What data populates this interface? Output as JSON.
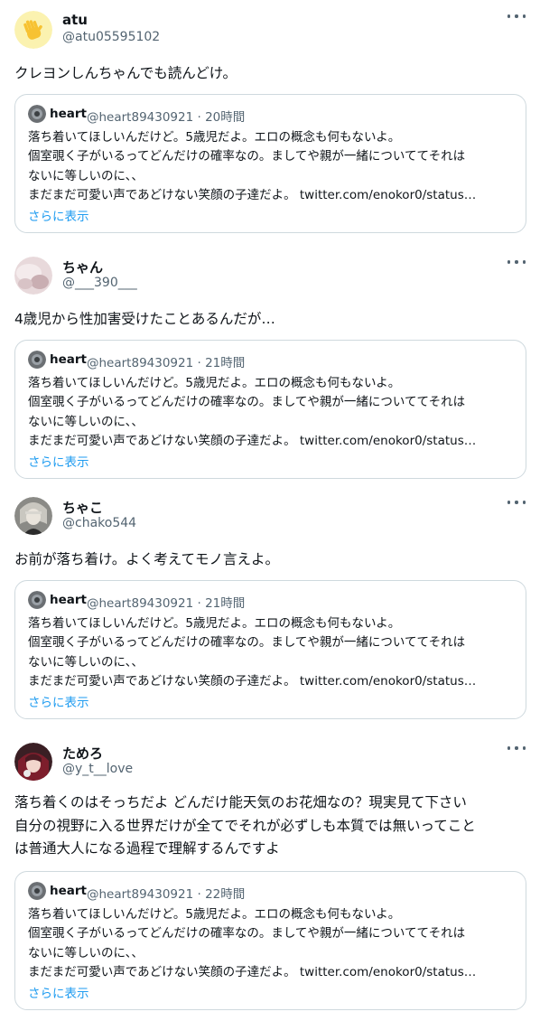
{
  "tweets": [
    {
      "name": "atu",
      "handle": "@atu05595102",
      "text": "クレヨンしんちゃんでも読んどけ。",
      "quote": {
        "name": "heart",
        "handle_time": "@heart89430921 · 20時間",
        "lines": [
          "落ち着いてほしいんだけど。5歳児だよ。エロの概念も何もないよ。",
          "個室覗く子がいるってどんだけの確率なの。ましてや親が一緒についててそれは",
          "ないに等しいのに、、",
          "まだまだ可愛い声であどけない笑顔の子達だよ。 twitter.com/enokor0/status…"
        ],
        "more_label": "さらに表示"
      }
    },
    {
      "name": "ちゃん",
      "handle": "@___390___",
      "text": "4歳児から性加害受けたことあるんだが…",
      "quote": {
        "name": "heart",
        "handle_time": "@heart89430921 · 21時間",
        "lines": [
          "落ち着いてほしいんだけど。5歳児だよ。エロの概念も何もないよ。",
          "個室覗く子がいるってどんだけの確率なの。ましてや親が一緒についててそれは",
          "ないに等しいのに、、",
          "まだまだ可愛い声であどけない笑顔の子達だよ。 twitter.com/enokor0/status…"
        ],
        "more_label": "さらに表示"
      }
    },
    {
      "name": "ちゃこ",
      "handle": "@chako544",
      "text": "お前が落ち着け。よく考えてモノ言えよ。",
      "quote": {
        "name": "heart",
        "handle_time": "@heart89430921 · 21時間",
        "lines": [
          "落ち着いてほしいんだけど。5歳児だよ。エロの概念も何もないよ。",
          "個室覗く子がいるってどんだけの確率なの。ましてや親が一緒についててそれは",
          "ないに等しいのに、、",
          "まだまだ可愛い声であどけない笑顔の子達だよ。 twitter.com/enokor0/status…"
        ],
        "more_label": "さらに表示"
      }
    },
    {
      "name": "ためろ",
      "handle": "@y_t__love",
      "text": "落ち着くのはそっちだよ どんだけ能天気のお花畑なの？現実見て下さい\n自分の視野に入る世界だけが全てでそれが必ずしも本質では無いってこと\nは普通大人になる過程で理解するんですよ",
      "quote": {
        "name": "heart",
        "handle_time": "@heart89430921 · 22時間",
        "lines": [
          "落ち着いてほしいんだけど。5歳児だよ。エロの概念も何もないよ。",
          "個室覗く子がいるってどんだけの確率なの。ましてや親が一緒についててそれは",
          "ないに等しいのに、、",
          "まだまだ可愛い声であどけない笑顔の子達だよ。 twitter.com/enokor0/status…"
        ],
        "more_label": "さらに表示"
      }
    }
  ],
  "colors": {
    "text": "#0f1419",
    "secondary": "#536471",
    "link": "#1d9bf0",
    "border": "#cfd9de"
  }
}
